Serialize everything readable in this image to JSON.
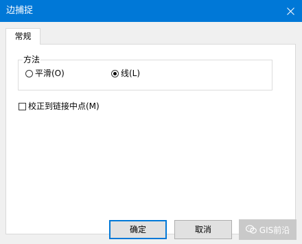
{
  "window": {
    "title": "边捕捉",
    "close_label": "×"
  },
  "tabs": [
    {
      "label": "常规",
      "selected": true
    }
  ],
  "method_group": {
    "legend": "方法",
    "options": [
      {
        "label": "平滑(O)",
        "selected": false
      },
      {
        "label": "线(L)",
        "selected": true
      }
    ]
  },
  "snap_midpoint": {
    "label": "校正到链接中点(M)",
    "checked": false
  },
  "buttons": {
    "ok_label": "确定",
    "cancel_label": "取消"
  },
  "watermark": {
    "text": "GIS前沿",
    "icon": "wechat-icon"
  },
  "colors": {
    "titlebar": "#0078d7",
    "focus_border": "#0078d7"
  }
}
